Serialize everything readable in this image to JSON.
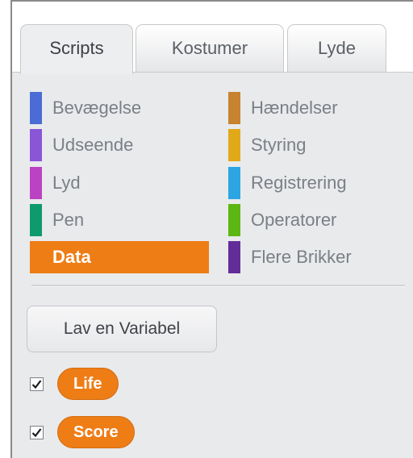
{
  "tabs": [
    {
      "label": "Scripts",
      "active": true
    },
    {
      "label": "Kostumer",
      "active": false
    },
    {
      "label": "Lyde",
      "active": false
    }
  ],
  "categories": {
    "left": [
      {
        "label": "Bevægelse",
        "color": "#4a6cd4"
      },
      {
        "label": "Udseende",
        "color": "#8a55d7"
      },
      {
        "label": "Lyd",
        "color": "#bb42c3"
      },
      {
        "label": "Pen",
        "color": "#0e9a6c"
      },
      {
        "label": "Data",
        "color": "#ee7d16",
        "selected": true
      }
    ],
    "right": [
      {
        "label": "Hændelser",
        "color": "#c88330"
      },
      {
        "label": "Styring",
        "color": "#e1a91a"
      },
      {
        "label": "Registrering",
        "color": "#2ca5e2"
      },
      {
        "label": "Operatorer",
        "color": "#5cb712"
      },
      {
        "label": "Flere Brikker",
        "color": "#632d99"
      }
    ]
  },
  "make_variable_button": "Lav en Variabel",
  "variables": [
    {
      "name": "Life",
      "checked": true
    },
    {
      "name": "Score",
      "checked": true
    }
  ],
  "colors": {
    "accent": "#ee7d16",
    "panel_background": "#e8eaec"
  }
}
